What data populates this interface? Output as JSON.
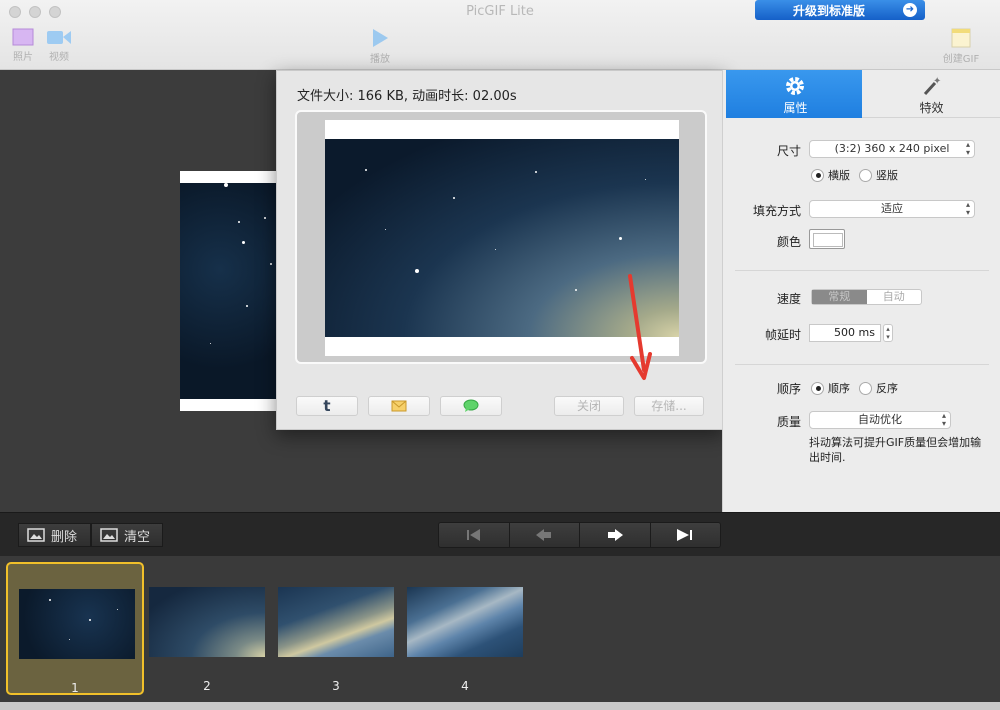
{
  "window": {
    "title": "PicGIF Lite",
    "upgrade_label": "升级到标准版"
  },
  "toolbar": {
    "photo_label": "照片",
    "video_label": "视频",
    "play_label": "播放",
    "create_label": "创建GIF"
  },
  "export_sheet": {
    "info": "文件大小: 166 KB, 动画时长: 02.00s",
    "close_label": "关闭",
    "save_label": "存储..."
  },
  "panel": {
    "tabs": [
      {
        "label": "属性"
      },
      {
        "label": "特效"
      }
    ],
    "size_label": "尺寸",
    "size_value": "(3:2) 360 x 240 pixel",
    "orientation": {
      "landscape": "横版",
      "portrait": "竖版",
      "selected": "landscape"
    },
    "fill_label": "填充方式",
    "fill_value": "适应",
    "color_label": "颜色",
    "color_value": "#ffffff",
    "speed_label": "速度",
    "speed_options": [
      "常规",
      "自动"
    ],
    "speed_selected": "常规",
    "delay_label": "帧延时",
    "delay_value": "500 ms",
    "order_label": "顺序",
    "order": {
      "forward": "顺序",
      "reverse": "反序",
      "selected": "forward"
    },
    "quality_label": "质量",
    "quality_value": "自动优化",
    "quality_note": "抖动算法可提升GIF质量但会增加输出时间."
  },
  "controls": {
    "delete_label": "删除",
    "clear_label": "清空"
  },
  "filmstrip": {
    "frames": [
      {
        "number": "1",
        "selected": true
      },
      {
        "number": "2",
        "selected": false
      },
      {
        "number": "3",
        "selected": false
      },
      {
        "number": "4",
        "selected": false
      }
    ]
  },
  "colors": {
    "accent": "#1f7fe0",
    "selection": "#f1c02a",
    "annotation_arrow": "#e53a2f"
  }
}
